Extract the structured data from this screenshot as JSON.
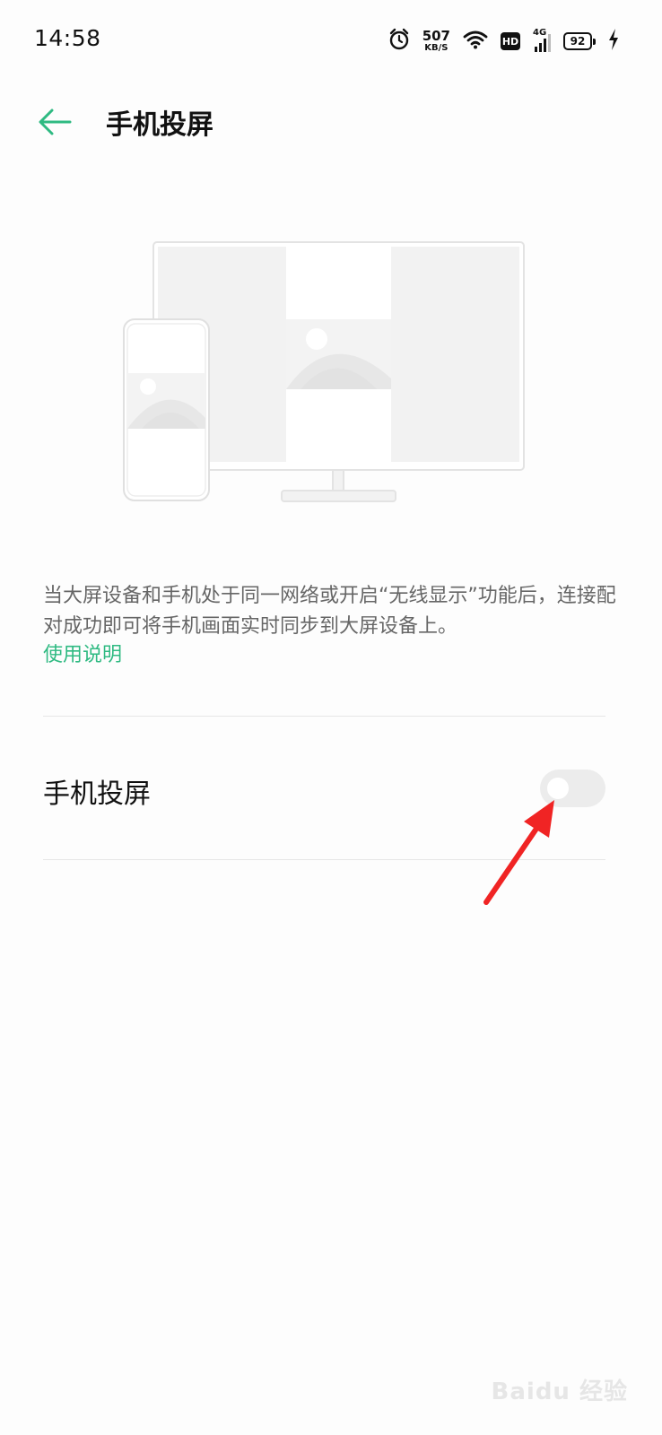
{
  "status_bar": {
    "time": "14:58",
    "net_speed_value": "507",
    "net_speed_unit": "KB/S",
    "hd_label": "HD",
    "signal_label": "4G",
    "battery_level": "92",
    "icons": [
      "alarm-icon",
      "wifi-icon",
      "hd-icon",
      "signal-icon",
      "battery-icon",
      "charging-icon"
    ]
  },
  "header": {
    "back_icon": "arrow-left-icon",
    "title": "手机投屏"
  },
  "illustration": {
    "name": "phone-to-tv-illustration"
  },
  "description": {
    "text": "当大屏设备和手机处于同一网络或开启“无线显示”功能后，连接配对成功即可将手机画面实时同步到大屏设备上。",
    "help_link": "使用说明"
  },
  "toggle": {
    "label": "手机投屏",
    "enabled": false
  },
  "watermark": {
    "text": "Baidu 经验"
  },
  "colors": {
    "accent": "#2fba82",
    "annotation": "#f02424",
    "toggle_off_bg": "#ececec",
    "description_text": "#666666"
  }
}
